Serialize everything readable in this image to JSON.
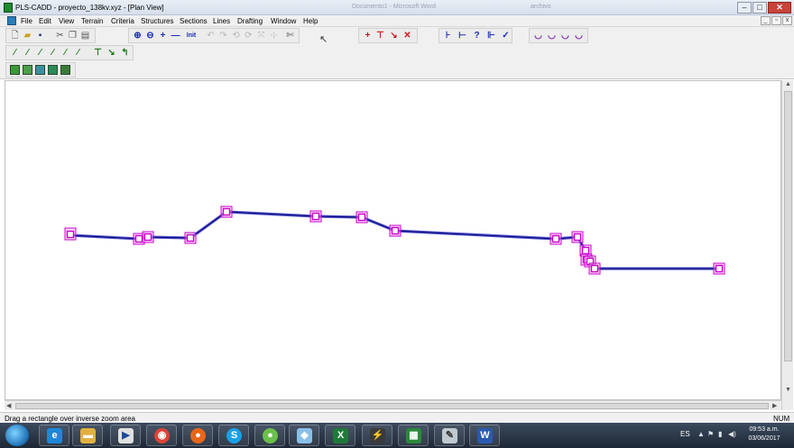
{
  "window": {
    "title": "PLS-CADD - proyecto_138kv.xyz - [Plan View]",
    "ghost_title_1": "Documento1 - Microsoft Word",
    "ghost_title_2": "archivo",
    "minimize": "–",
    "maximize": "□",
    "close": "✕"
  },
  "menu": {
    "items": [
      "File",
      "Edit",
      "View",
      "Terrain",
      "Criteria",
      "Structures",
      "Sections",
      "Lines",
      "Drafting",
      "Window",
      "Help"
    ],
    "mdi_min": "_",
    "mdi_restore": "▫",
    "mdi_close": "x"
  },
  "toolbar": {
    "icons": [
      "new-file-icon",
      "open-folder-icon",
      "save-icon",
      "cut-icon",
      "copy-icon",
      "paste-icon",
      "zoom-in-icon",
      "zoom-out-icon",
      "pan-plus-icon",
      "pan-minus-icon",
      "zoom-all-icon",
      "structure-add-icon",
      "structure-move-icon",
      "structure-delete-icon",
      "section-tools-icon",
      "sag-tools-icon"
    ],
    "zoom_all_label": "Init"
  },
  "plan_view": {
    "line_color": "#1a1aa0",
    "structure_color": "#cc00cc",
    "structures_count_visible": 17
  },
  "status": {
    "message": "Drag a rectangle over inverse zoom area",
    "num": "NUM"
  },
  "taskbar": {
    "apps": [
      "internet-explorer-icon",
      "file-explorer-icon",
      "media-player-icon",
      "chrome-icon",
      "firefox-icon",
      "skype-icon",
      "messenger-icon",
      "app-icon",
      "excel-icon",
      "pls-cadd-icon",
      "pls-cadd-alt-icon",
      "paint-icon",
      "word-icon"
    ],
    "language": "ES",
    "time": "09:53 a.m.",
    "date": "03/06/2017"
  }
}
